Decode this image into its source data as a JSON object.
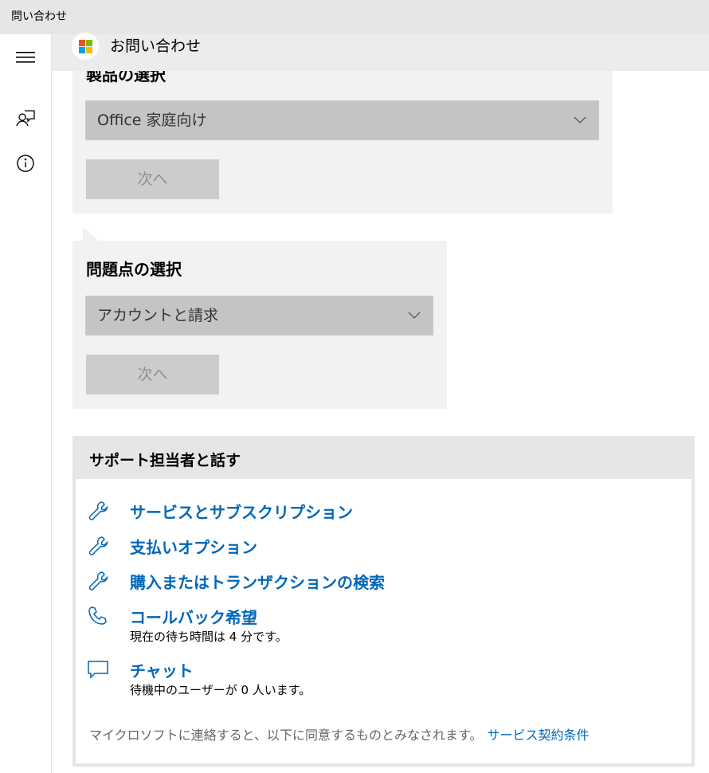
{
  "window": {
    "title": "問い合わせ"
  },
  "sidebar": {
    "items": [
      {
        "icon": "hamburger-menu-icon"
      },
      {
        "icon": "contact-support-icon"
      },
      {
        "icon": "info-icon"
      }
    ]
  },
  "header": {
    "title": "お問い合わせ",
    "logo": "microsoft-logo"
  },
  "product_card": {
    "heading": "製品の選択",
    "selected": "Office 家庭向け",
    "next_label": "次へ"
  },
  "issue_card": {
    "heading": "問題点の選択",
    "selected": "アカウントと請求",
    "next_label": "次へ"
  },
  "support": {
    "heading": "サポート担当者と話す",
    "options": [
      {
        "label": "サービスとサブスクリプション",
        "icon": "wrench-icon"
      },
      {
        "label": "支払いオプション",
        "icon": "wrench-icon"
      },
      {
        "label": "購入またはトランザクションの検索",
        "icon": "wrench-icon"
      },
      {
        "label": "コールバック希望",
        "sub": "現在の待ち時間は 4 分です。",
        "icon": "phone-icon"
      },
      {
        "label": "チャット",
        "sub": "待機中のユーザーが 0 人います。",
        "icon": "chat-icon"
      }
    ],
    "footer_text": "マイクロソフトに連絡すると、以下に同意するものとみなされます。",
    "footer_link": "サービス契約条件"
  },
  "colors": {
    "accent": "#0067b8",
    "titlebar": "#e6e6e6",
    "card": "#f2f2f2",
    "dropdown": "#c4c4c4"
  }
}
